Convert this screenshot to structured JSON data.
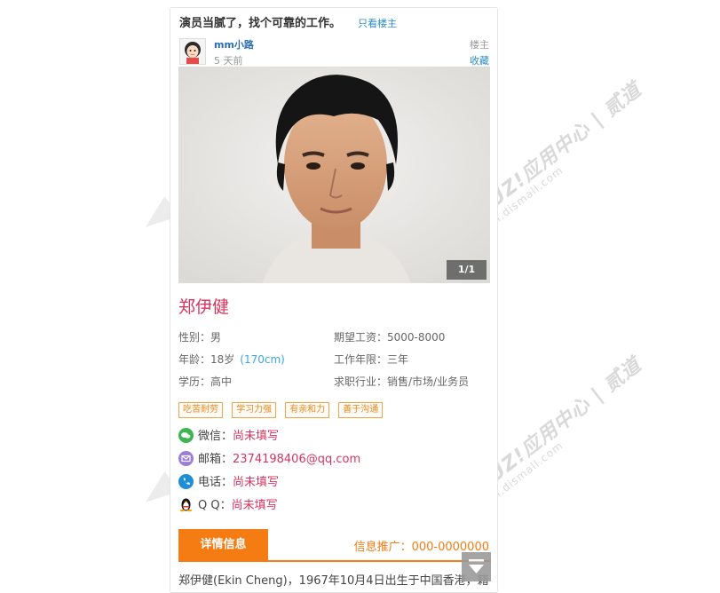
{
  "post": {
    "title": "演员当腻了，找个可靠的工作。",
    "only_op_link": "只看楼主",
    "username": "mm小路",
    "time": "5 天前",
    "op_label": "楼主",
    "fav_link": "收藏"
  },
  "photo": {
    "counter": "1/1"
  },
  "profile": {
    "name": "郑伊健",
    "gender": "性别：男",
    "age": "年龄：18岁",
    "height": "(170cm)",
    "education": "学历：高中",
    "salary": "期望工资：5000-8000",
    "work_years": "工作年限：三年",
    "industry": "求职行业：销售/市场/业务员",
    "tags": [
      "吃苦耐劳",
      "学习力强",
      "有亲和力",
      "善于沟通"
    ]
  },
  "contacts": {
    "wechat_label": "微信：",
    "wechat_value": "尚未填写",
    "email_label": "邮箱：",
    "email_value": "2374198406@qq.com",
    "phone_label": "电话：",
    "phone_value": "尚未填写",
    "qq_label": "Q Q：",
    "qq_value": "尚未填写",
    "icon_colors": {
      "wechat": "#3cb550",
      "email": "#9b7ed8",
      "phone": "#1e8fd6",
      "qq": "#000000"
    }
  },
  "tabs": {
    "detail_label": "详情信息",
    "promo_text": "信息推广：000-0000000"
  },
  "description": "郑伊健(Ekin Cheng)，1967年10月4日出生于中国香港，籍",
  "watermark": {
    "brand": "DISCUZ!应用中心 | 贰道",
    "url": "addon.dismall.com"
  },
  "colors": {
    "accent": "#f57b13",
    "name": "#d8345f",
    "link": "#2a8ec9"
  }
}
